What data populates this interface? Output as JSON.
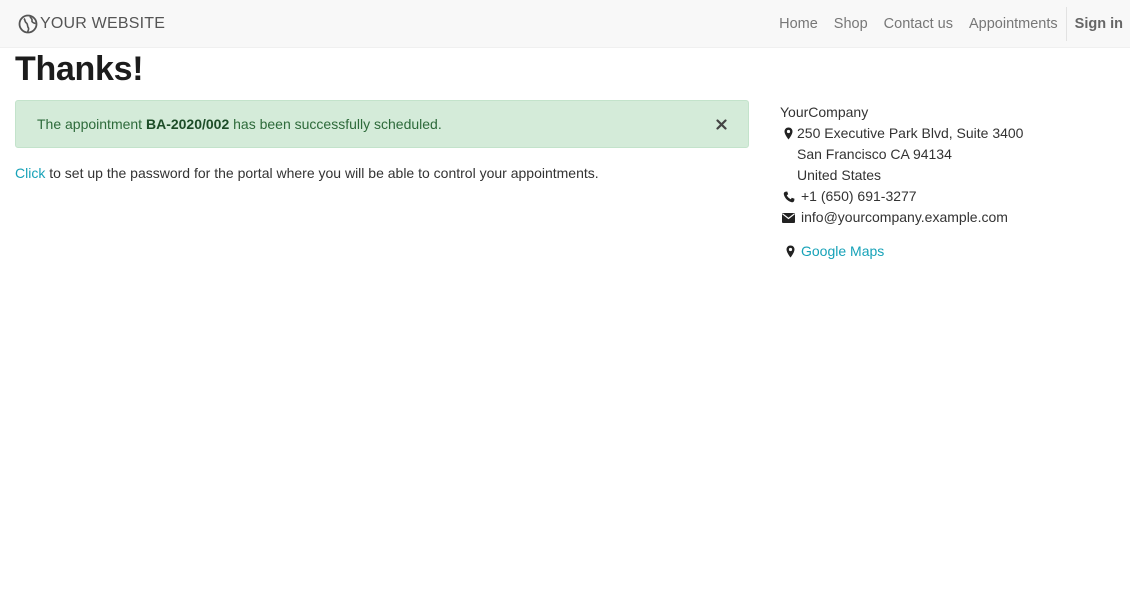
{
  "navbar": {
    "brand": "YOUR WEBSITE",
    "links": [
      "Home",
      "Shop",
      "Contact us",
      "Appointments"
    ],
    "signin": "Sign in"
  },
  "page": {
    "title": "Thanks!"
  },
  "alert": {
    "prefix": "The appointment ",
    "reference": "BA-2020/002",
    "suffix": " has been successfully scheduled.",
    "close_symbol": "×"
  },
  "portal": {
    "link_text": "Click",
    "rest": " to set up the password for the portal where you will be able to control your appointments."
  },
  "contact": {
    "company": "YourCompany",
    "address_line1": "250 Executive Park Blvd, Suite 3400",
    "address_line2": "San Francisco CA 94134",
    "address_line3": "United States",
    "phone": "+1 (650) 691-3277",
    "email": "info@yourcompany.example.com",
    "maps_label": "Google Maps"
  },
  "colors": {
    "link": "#17a2b8",
    "alert_bg": "#d4ebd9",
    "navbar_bg": "#f8f8f8"
  }
}
